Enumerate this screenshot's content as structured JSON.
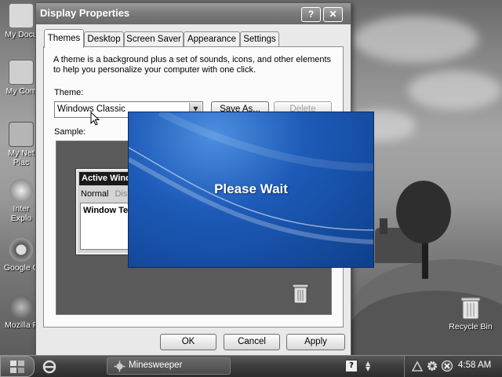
{
  "desktop": {
    "icons": [
      {
        "label": "My Docu",
        "icon": "my-documents-icon"
      },
      {
        "label": "My Com",
        "icon": "my-computer-icon"
      },
      {
        "label": "My Net",
        "label2": "Plac",
        "icon": "network-places-icon"
      },
      {
        "label": "Inter",
        "label2": "Explo",
        "icon": "internet-explorer-icon"
      },
      {
        "label": "Google C",
        "icon": "google-chrome-icon"
      },
      {
        "label": "Mozilla F",
        "icon": "mozilla-firefox-icon"
      }
    ],
    "recycle_bin": {
      "label": "Recycle Bin",
      "icon": "recycle-bin-icon"
    }
  },
  "window": {
    "title": "Display Properties",
    "help_label": "?",
    "close_label": "✕",
    "tabs": [
      {
        "label": "Themes",
        "active": true
      },
      {
        "label": "Desktop",
        "active": false
      },
      {
        "label": "Screen Saver",
        "active": false
      },
      {
        "label": "Appearance",
        "active": false
      },
      {
        "label": "Settings",
        "active": false
      }
    ],
    "description": "A theme is a background plus a set of sounds, icons, and other elements to help you personalize your computer with one click.",
    "theme_label": "Theme:",
    "theme_value": "Windows Classic",
    "save_as_label": "Save As...",
    "delete_label": "Delete",
    "sample_label": "Sample:",
    "sample": {
      "active_window_title": "Active Wind",
      "menu_normal": "Normal",
      "menu_disabled": "Dis",
      "window_text": "Window Te"
    },
    "ok_label": "OK",
    "cancel_label": "Cancel",
    "apply_label": "Apply"
  },
  "overlay": {
    "text": "Please Wait"
  },
  "taskbar": {
    "task_label": "Minesweeper",
    "clock": "4:58 AM"
  },
  "colors": {
    "overlay_blue": "#1d5bb8",
    "titlebar": "#7a7a7a",
    "taskbar": "#3c3c3c"
  }
}
